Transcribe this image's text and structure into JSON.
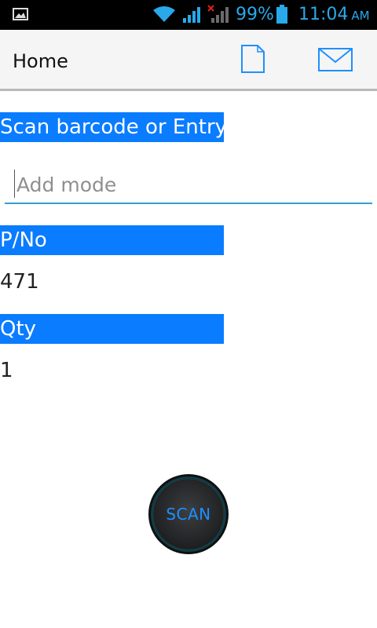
{
  "status_bar": {
    "battery_percent": "99%",
    "time": "11:04",
    "ampm": "AM"
  },
  "action_bar": {
    "title": "Home",
    "icons": [
      "document-icon",
      "mail-icon"
    ]
  },
  "form": {
    "scan_header": "Scan barcode or Entry",
    "input_placeholder": "Add mode",
    "input_value": "",
    "pno_label": "P/No",
    "pno_value": "471",
    "qty_label": "Qty",
    "qty_value": "1"
  },
  "scan_button": {
    "label": "SCAN"
  },
  "colors": {
    "accent": "#0a7cff",
    "statusbar_text": "#2aa9ea",
    "input_underline": "#33a1c9"
  }
}
